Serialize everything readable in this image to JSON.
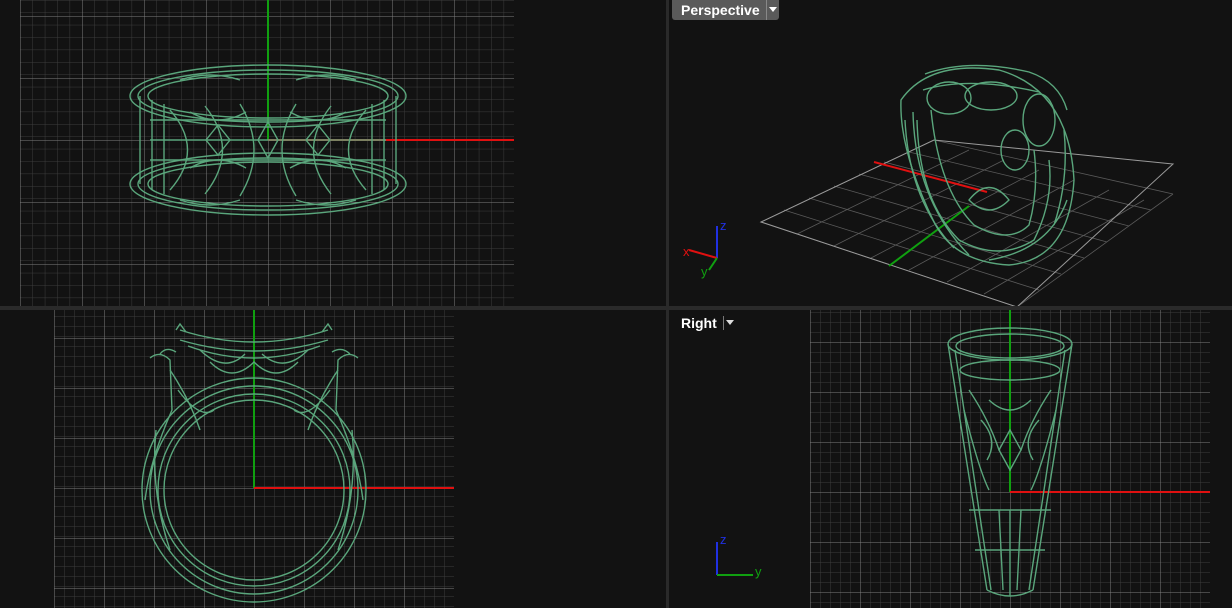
{
  "viewports": {
    "top": {
      "label": ""
    },
    "perspective": {
      "label": "Perspective",
      "menu_icon": "chevron-down-icon"
    },
    "front": {
      "label": ""
    },
    "right": {
      "label": "Right",
      "menu_icon": "chevron-down-icon"
    }
  },
  "axis_widget": {
    "perspective": {
      "x": "x",
      "y": "y",
      "z": "z"
    },
    "right": {
      "y": "y",
      "z": "z"
    }
  },
  "colors": {
    "viewport_bg": "#121212",
    "grid_minor": "#3c3c3c",
    "grid_major": "#8a8a8a",
    "x_axis": "#e01010",
    "y_axis": "#10a010",
    "model": "#5aa67c",
    "label_bg": "#5a5a5a"
  }
}
